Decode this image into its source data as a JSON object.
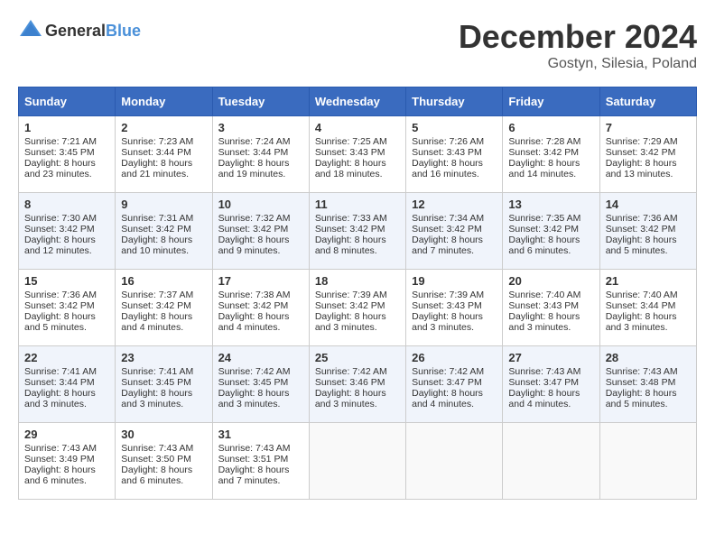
{
  "header": {
    "logo_general": "General",
    "logo_blue": "Blue",
    "month": "December 2024",
    "location": "Gostyn, Silesia, Poland"
  },
  "days_of_week": [
    "Sunday",
    "Monday",
    "Tuesday",
    "Wednesday",
    "Thursday",
    "Friday",
    "Saturday"
  ],
  "weeks": [
    [
      {
        "day": "1",
        "sunrise": "Sunrise: 7:21 AM",
        "sunset": "Sunset: 3:45 PM",
        "daylight": "Daylight: 8 hours and 23 minutes."
      },
      {
        "day": "2",
        "sunrise": "Sunrise: 7:23 AM",
        "sunset": "Sunset: 3:44 PM",
        "daylight": "Daylight: 8 hours and 21 minutes."
      },
      {
        "day": "3",
        "sunrise": "Sunrise: 7:24 AM",
        "sunset": "Sunset: 3:44 PM",
        "daylight": "Daylight: 8 hours and 19 minutes."
      },
      {
        "day": "4",
        "sunrise": "Sunrise: 7:25 AM",
        "sunset": "Sunset: 3:43 PM",
        "daylight": "Daylight: 8 hours and 18 minutes."
      },
      {
        "day": "5",
        "sunrise": "Sunrise: 7:26 AM",
        "sunset": "Sunset: 3:43 PM",
        "daylight": "Daylight: 8 hours and 16 minutes."
      },
      {
        "day": "6",
        "sunrise": "Sunrise: 7:28 AM",
        "sunset": "Sunset: 3:42 PM",
        "daylight": "Daylight: 8 hours and 14 minutes."
      },
      {
        "day": "7",
        "sunrise": "Sunrise: 7:29 AM",
        "sunset": "Sunset: 3:42 PM",
        "daylight": "Daylight: 8 hours and 13 minutes."
      }
    ],
    [
      {
        "day": "8",
        "sunrise": "Sunrise: 7:30 AM",
        "sunset": "Sunset: 3:42 PM",
        "daylight": "Daylight: 8 hours and 12 minutes."
      },
      {
        "day": "9",
        "sunrise": "Sunrise: 7:31 AM",
        "sunset": "Sunset: 3:42 PM",
        "daylight": "Daylight: 8 hours and 10 minutes."
      },
      {
        "day": "10",
        "sunrise": "Sunrise: 7:32 AM",
        "sunset": "Sunset: 3:42 PM",
        "daylight": "Daylight: 8 hours and 9 minutes."
      },
      {
        "day": "11",
        "sunrise": "Sunrise: 7:33 AM",
        "sunset": "Sunset: 3:42 PM",
        "daylight": "Daylight: 8 hours and 8 minutes."
      },
      {
        "day": "12",
        "sunrise": "Sunrise: 7:34 AM",
        "sunset": "Sunset: 3:42 PM",
        "daylight": "Daylight: 8 hours and 7 minutes."
      },
      {
        "day": "13",
        "sunrise": "Sunrise: 7:35 AM",
        "sunset": "Sunset: 3:42 PM",
        "daylight": "Daylight: 8 hours and 6 minutes."
      },
      {
        "day": "14",
        "sunrise": "Sunrise: 7:36 AM",
        "sunset": "Sunset: 3:42 PM",
        "daylight": "Daylight: 8 hours and 5 minutes."
      }
    ],
    [
      {
        "day": "15",
        "sunrise": "Sunrise: 7:36 AM",
        "sunset": "Sunset: 3:42 PM",
        "daylight": "Daylight: 8 hours and 5 minutes."
      },
      {
        "day": "16",
        "sunrise": "Sunrise: 7:37 AM",
        "sunset": "Sunset: 3:42 PM",
        "daylight": "Daylight: 8 hours and 4 minutes."
      },
      {
        "day": "17",
        "sunrise": "Sunrise: 7:38 AM",
        "sunset": "Sunset: 3:42 PM",
        "daylight": "Daylight: 8 hours and 4 minutes."
      },
      {
        "day": "18",
        "sunrise": "Sunrise: 7:39 AM",
        "sunset": "Sunset: 3:42 PM",
        "daylight": "Daylight: 8 hours and 3 minutes."
      },
      {
        "day": "19",
        "sunrise": "Sunrise: 7:39 AM",
        "sunset": "Sunset: 3:43 PM",
        "daylight": "Daylight: 8 hours and 3 minutes."
      },
      {
        "day": "20",
        "sunrise": "Sunrise: 7:40 AM",
        "sunset": "Sunset: 3:43 PM",
        "daylight": "Daylight: 8 hours and 3 minutes."
      },
      {
        "day": "21",
        "sunrise": "Sunrise: 7:40 AM",
        "sunset": "Sunset: 3:44 PM",
        "daylight": "Daylight: 8 hours and 3 minutes."
      }
    ],
    [
      {
        "day": "22",
        "sunrise": "Sunrise: 7:41 AM",
        "sunset": "Sunset: 3:44 PM",
        "daylight": "Daylight: 8 hours and 3 minutes."
      },
      {
        "day": "23",
        "sunrise": "Sunrise: 7:41 AM",
        "sunset": "Sunset: 3:45 PM",
        "daylight": "Daylight: 8 hours and 3 minutes."
      },
      {
        "day": "24",
        "sunrise": "Sunrise: 7:42 AM",
        "sunset": "Sunset: 3:45 PM",
        "daylight": "Daylight: 8 hours and 3 minutes."
      },
      {
        "day": "25",
        "sunrise": "Sunrise: 7:42 AM",
        "sunset": "Sunset: 3:46 PM",
        "daylight": "Daylight: 8 hours and 3 minutes."
      },
      {
        "day": "26",
        "sunrise": "Sunrise: 7:42 AM",
        "sunset": "Sunset: 3:47 PM",
        "daylight": "Daylight: 8 hours and 4 minutes."
      },
      {
        "day": "27",
        "sunrise": "Sunrise: 7:43 AM",
        "sunset": "Sunset: 3:47 PM",
        "daylight": "Daylight: 8 hours and 4 minutes."
      },
      {
        "day": "28",
        "sunrise": "Sunrise: 7:43 AM",
        "sunset": "Sunset: 3:48 PM",
        "daylight": "Daylight: 8 hours and 5 minutes."
      }
    ],
    [
      {
        "day": "29",
        "sunrise": "Sunrise: 7:43 AM",
        "sunset": "Sunset: 3:49 PM",
        "daylight": "Daylight: 8 hours and 6 minutes."
      },
      {
        "day": "30",
        "sunrise": "Sunrise: 7:43 AM",
        "sunset": "Sunset: 3:50 PM",
        "daylight": "Daylight: 8 hours and 6 minutes."
      },
      {
        "day": "31",
        "sunrise": "Sunrise: 7:43 AM",
        "sunset": "Sunset: 3:51 PM",
        "daylight": "Daylight: 8 hours and 7 minutes."
      },
      null,
      null,
      null,
      null
    ]
  ]
}
